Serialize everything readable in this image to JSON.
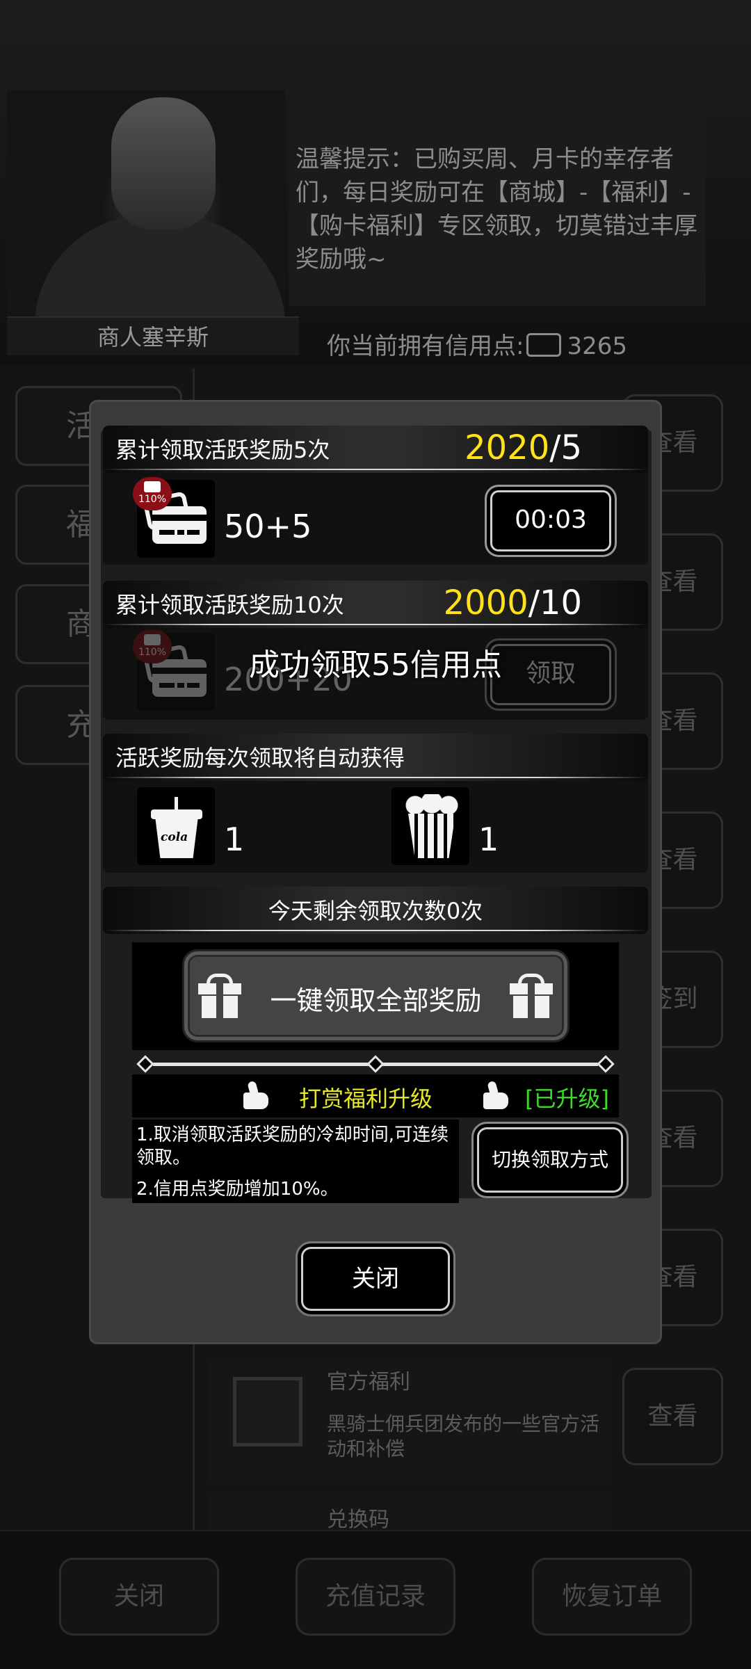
{
  "background": {
    "merchant_name": "商人塞辛斯",
    "tip_text": "温馨提示：已购买周、月卡的幸存者们，每日奖励可在【商城】-【福利】-【购卡福利】专区领取，切莫错过丰厚奖励哦~",
    "credits_label": "你当前拥有信用点:",
    "credits_value": "3265",
    "side_tabs": [
      "活",
      "福",
      "商",
      "充"
    ],
    "right_buttons": [
      "查看",
      "查看",
      "查看",
      "查看",
      "签到",
      "查看",
      "查看",
      "查看"
    ],
    "list_item_official_title": "官方福利",
    "list_item_official_desc": "黑骑士佣兵团发布的一些官方活动和补偿",
    "list_item_redeem_title": "兑换码",
    "bottom_buttons": [
      "关闭",
      "充值记录",
      "恢复订单"
    ]
  },
  "dialog": {
    "reward5": {
      "title": "累计领取活跃奖励5次",
      "count_current": "2020",
      "count_target": "/5",
      "badge": "110%",
      "value": "50+5",
      "button": "00:03"
    },
    "reward10": {
      "title": "累计领取活跃奖励10次",
      "count_current": "2000",
      "count_target": "/10",
      "badge": "110%",
      "value": "200+20",
      "button": "领取"
    },
    "auto_rewards": {
      "title": "活跃奖励每次领取将自动获得",
      "cola_label": "cola",
      "cola_qty": "1",
      "popcorn_qty": "1"
    },
    "remaining": "今天剩余领取次数0次",
    "claim_all_button": "一键领取全部奖励",
    "upgrade_label": "打赏福利升级",
    "upgrade_status": "[已升级]",
    "desc_1": "1.取消领取活跃奖励的冷却时间,可连续领取。",
    "desc_2": "2.信用点奖励增加10%。",
    "switch_button": "切换领取方式",
    "close_button": "关闭"
  },
  "toast": "成功领取55信用点",
  "colors": {
    "count_highlight": "#ffe21a",
    "upgrade_yellow": "#e8e82a",
    "upgraded_green": "#3ddc2a",
    "badge_red": "#8b0f17"
  }
}
